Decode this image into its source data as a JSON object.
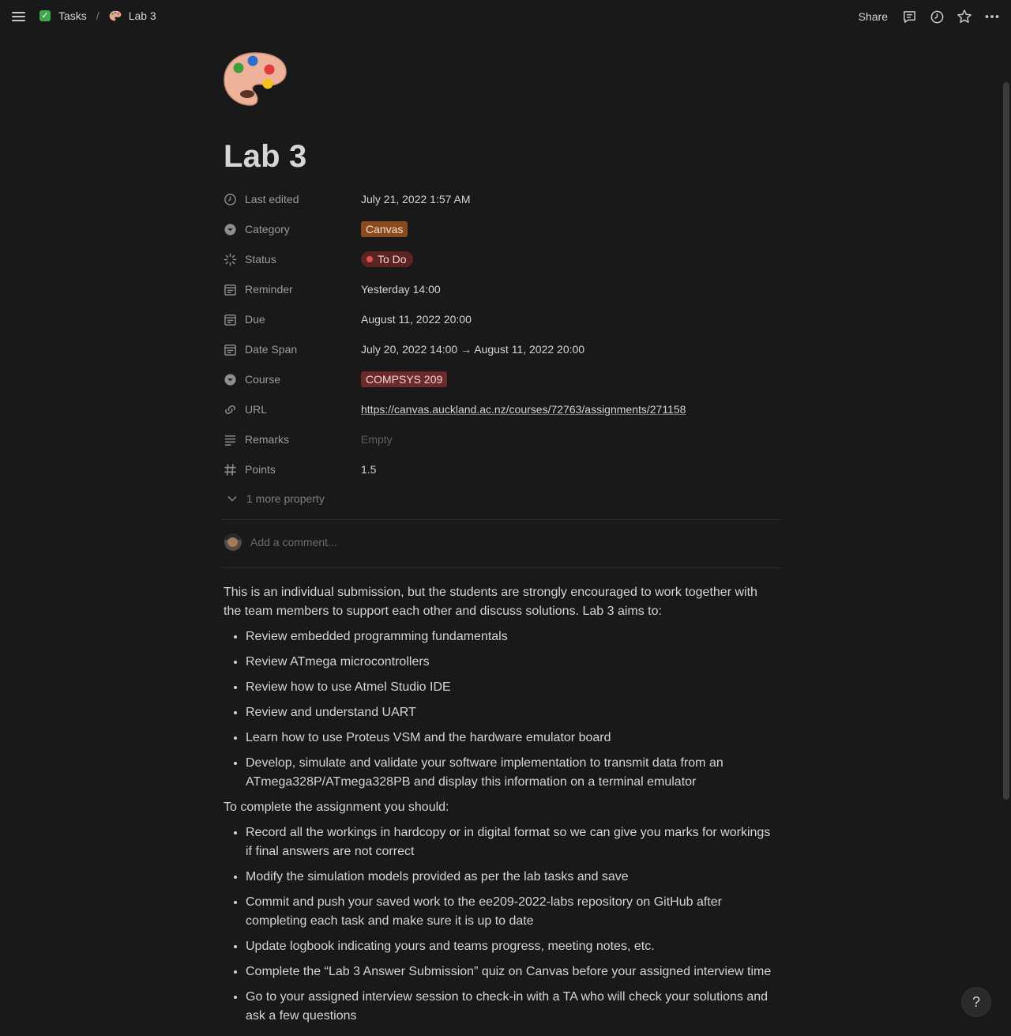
{
  "breadcrumb": {
    "parent": "Tasks",
    "separator": "/",
    "current": "Lab 3"
  },
  "topbar": {
    "share_label": "Share",
    "icons": [
      "comment-icon",
      "history-icon",
      "star-icon",
      "more-icon"
    ]
  },
  "page": {
    "icon": "palette-icon",
    "title": "Lab 3"
  },
  "properties": [
    {
      "name": "Last edited",
      "icon": "clock-icon",
      "value": "July 21, 2022 1:57 AM"
    },
    {
      "name": "Category",
      "icon": "select-icon",
      "value": "Canvas",
      "tag_color": "#8a4b1e"
    },
    {
      "name": "Status",
      "icon": "status-icon",
      "value": "To Do",
      "tag_color": "#5b2423"
    },
    {
      "name": "Reminder",
      "icon": "calendar-icon",
      "value": "Yesterday 14:00"
    },
    {
      "name": "Due",
      "icon": "calendar-icon",
      "value": "August 11, 2022 20:00"
    },
    {
      "name": "Date Span",
      "icon": "calendar-icon",
      "value": "July 20, 2022 14:00 → August 11, 2022 20:00"
    },
    {
      "name": "Course",
      "icon": "select-icon",
      "value": "COMPSYS 209",
      "tag_color": "#6b2b2b"
    },
    {
      "name": "URL",
      "icon": "link-icon",
      "value": "https://canvas.auckland.ac.nz/courses/72763/assignments/271158"
    },
    {
      "name": "Remarks",
      "icon": "text-icon",
      "value": "Empty"
    },
    {
      "name": "Points",
      "icon": "hash-icon",
      "value": "1.5"
    }
  ],
  "more_property": "1 more property",
  "comment": {
    "placeholder": "Add a comment..."
  },
  "body": {
    "intro": "This is an individual submission, but the students are strongly encouraged to work together with the team members to support each other and discuss solutions. Lab 3 aims to:",
    "aims": [
      "Review embedded programming fundamentals",
      "Review ATmega microcontrollers",
      "Review how to use Atmel Studio IDE",
      "Review and understand UART",
      "Learn how to use Proteus VSM and the hardware emulator board",
      "Develop, simulate and validate your software implementation to transmit data from an ATmega328P/ATmega328PB and display this information on a terminal emulator"
    ],
    "complete_intro": "To complete the assignment you should:",
    "steps": [
      "Record all the workings in hardcopy or in digital format so we can give you marks for workings if final answers are not correct",
      "Modify the simulation models provided as per the lab tasks and save",
      "Commit and push your saved work to the ee209-2022-labs repository on GitHub after completing each task and make sure it is up to date",
      "Update logbook indicating yours and teams progress, meeting notes, etc.",
      "Complete the “Lab 3 Answer Submission” quiz on Canvas before your assigned interview time",
      "Go to your assigned interview session to check-in with a TA who will check your solutions and ask a few questions"
    ]
  },
  "help_label": "?"
}
